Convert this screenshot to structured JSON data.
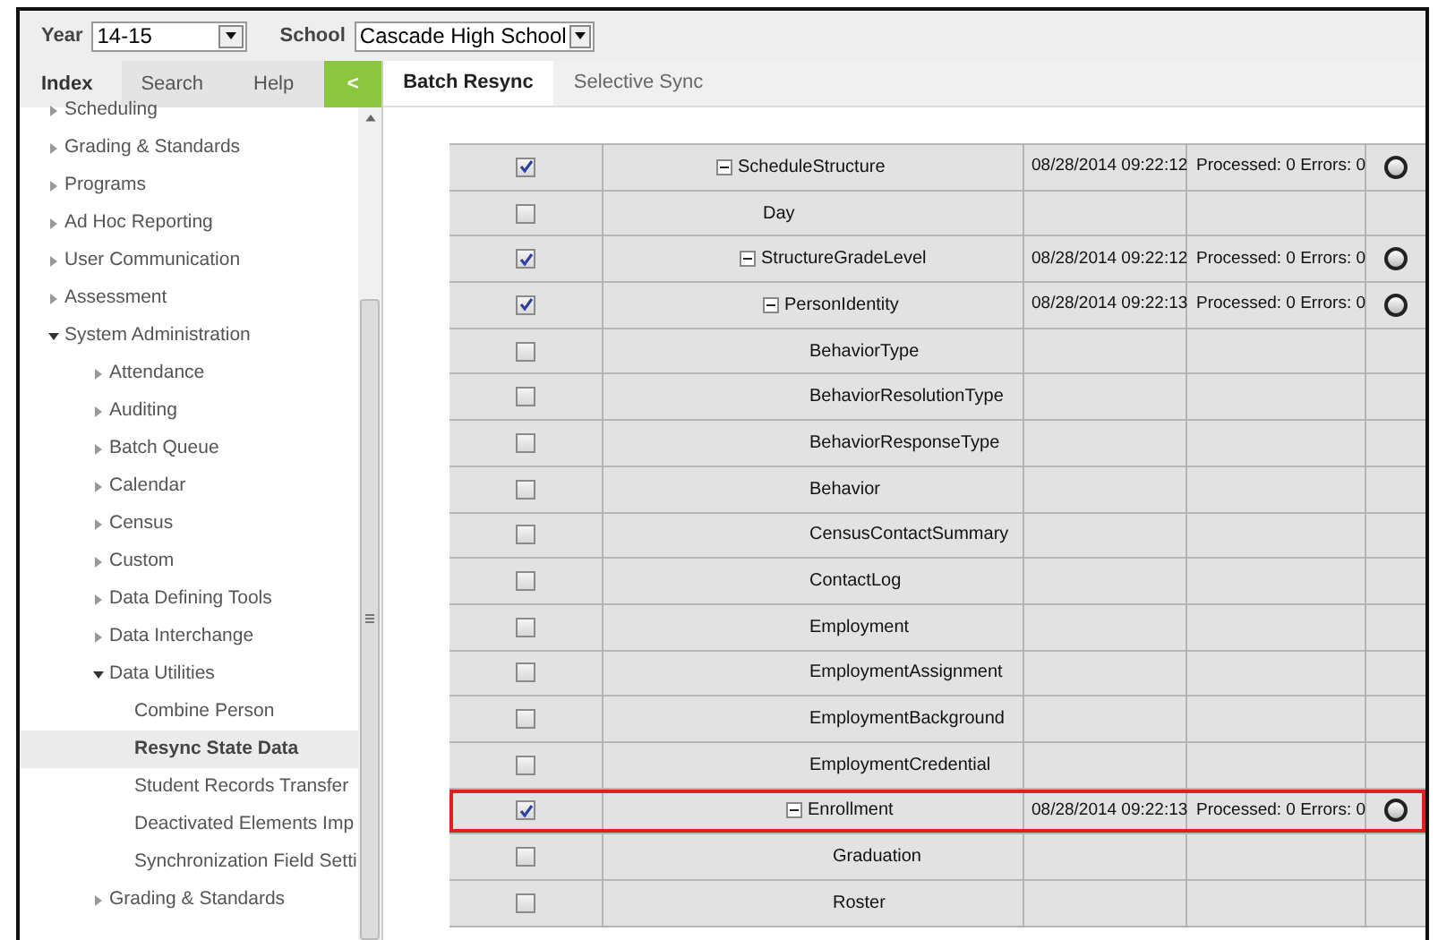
{
  "toolbar": {
    "year_label": "Year",
    "year": "14-15",
    "school_label": "School",
    "school": "Cascade High School"
  },
  "sidebar": {
    "tabs": [
      {
        "label": "Index",
        "selected": true
      },
      {
        "label": "Search",
        "selected": false
      },
      {
        "label": "Help",
        "selected": false
      }
    ],
    "collapse": "<",
    "items": [
      {
        "label": "Scheduling",
        "expanded": false,
        "selected": false
      },
      {
        "label": "Grading & Standards",
        "expanded": false,
        "selected": false
      },
      {
        "label": "Programs",
        "expanded": false,
        "selected": false
      },
      {
        "label": "Ad Hoc Reporting",
        "expanded": false,
        "selected": false
      },
      {
        "label": "User Communication",
        "expanded": false,
        "selected": false
      },
      {
        "label": "Assessment",
        "expanded": false,
        "selected": false
      },
      {
        "label": "System Administration",
        "expanded": true,
        "selected": false,
        "children": [
          {
            "label": "Attendance",
            "expanded": false,
            "selected": false
          },
          {
            "label": "Auditing",
            "expanded": false,
            "selected": false
          },
          {
            "label": "Batch Queue",
            "expanded": false,
            "selected": false
          },
          {
            "label": "Calendar",
            "expanded": false,
            "selected": false
          },
          {
            "label": "Census",
            "expanded": false,
            "selected": false
          },
          {
            "label": "Custom",
            "expanded": false,
            "selected": false
          },
          {
            "label": "Data Defining Tools",
            "expanded": false,
            "selected": false
          },
          {
            "label": "Data Interchange",
            "expanded": false,
            "selected": false
          },
          {
            "label": "Data Utilities",
            "expanded": true,
            "selected": false,
            "children": [
              {
                "label": "Combine Person",
                "selected": false
              },
              {
                "label": "Resync State Data",
                "selected": true
              },
              {
                "label": "Student Records Transfer",
                "selected": false
              },
              {
                "label": "Deactivated Elements Imp",
                "selected": false
              },
              {
                "label": "Synchronization Field Setti",
                "selected": false
              }
            ]
          },
          {
            "label": "Grading & Standards",
            "expanded": false,
            "selected": false
          }
        ]
      }
    ]
  },
  "tabs": [
    {
      "label": "Batch Resync",
      "selected": true
    },
    {
      "label": "Selective Sync",
      "selected": false
    }
  ],
  "table": {
    "rows": [
      {
        "name": "ScheduleStructure",
        "checked": true,
        "expanded": true,
        "highlighted": false,
        "date": "08/28/2014 09:22:12",
        "status": "Processed: 0 Errors: 0",
        "children": [
          {
            "name": "Day",
            "checked": false,
            "highlighted": false
          },
          {
            "name": "StructureGradeLevel",
            "checked": true,
            "expanded": true,
            "highlighted": false,
            "date": "08/28/2014 09:22:12",
            "status": "Processed: 0 Errors: 0",
            "children": [
              {
                "name": "PersonIdentity",
                "checked": true,
                "expanded": true,
                "highlighted": false,
                "date": "08/28/2014 09:22:13",
                "status": "Processed: 0 Errors: 0",
                "children": [
                  {
                    "name": "BehaviorType",
                    "checked": false,
                    "highlighted": false
                  },
                  {
                    "name": "BehaviorResolutionType",
                    "checked": false,
                    "highlighted": false
                  },
                  {
                    "name": "BehaviorResponseType",
                    "checked": false,
                    "highlighted": false
                  },
                  {
                    "name": "Behavior",
                    "checked": false,
                    "highlighted": false
                  },
                  {
                    "name": "CensusContactSummary",
                    "checked": false,
                    "highlighted": false
                  },
                  {
                    "name": "ContactLog",
                    "checked": false,
                    "highlighted": false
                  },
                  {
                    "name": "Employment",
                    "checked": false,
                    "highlighted": false
                  },
                  {
                    "name": "EmploymentAssignment",
                    "checked": false,
                    "highlighted": false
                  },
                  {
                    "name": "EmploymentBackground",
                    "checked": false,
                    "highlighted": false
                  },
                  {
                    "name": "EmploymentCredential",
                    "checked": false,
                    "highlighted": false
                  },
                  {
                    "name": "Enrollment",
                    "checked": true,
                    "expanded": true,
                    "highlighted": true,
                    "date": "08/28/2014 09:22:13",
                    "status": "Processed: 0 Errors: 0",
                    "children": [
                      {
                        "name": "Graduation",
                        "checked": false,
                        "highlighted": false
                      },
                      {
                        "name": "Roster",
                        "checked": false,
                        "highlighted": false
                      }
                    ]
                  }
                ]
              }
            ]
          }
        ]
      }
    ]
  }
}
